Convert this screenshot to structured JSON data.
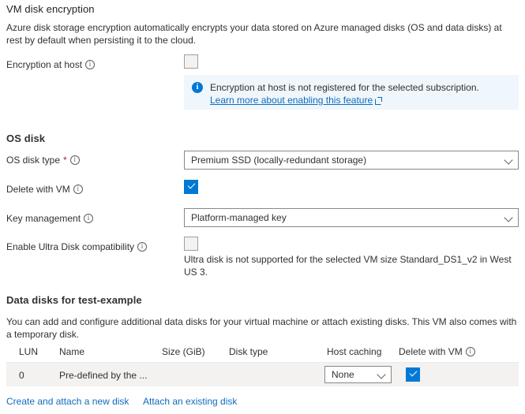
{
  "encryption_section": {
    "heading": "VM disk encryption",
    "description": "Azure disk storage encryption automatically encrypts your data stored on Azure managed disks (OS and data disks) at rest by default when persisting it to the cloud.",
    "encryption_at_host_label": "Encryption at host",
    "encryption_at_host_checked": false,
    "banner": {
      "icon": "info-icon",
      "message": "Encryption at host is not registered for the selected subscription.",
      "link_text": "Learn more about enabling this feature",
      "link_icon": "external-link-icon"
    }
  },
  "os_disk_section": {
    "heading": "OS disk",
    "os_disk_type": {
      "label": "OS disk type",
      "required_marker": "*",
      "value": "Premium SSD (locally-redundant storage)"
    },
    "delete_with_vm": {
      "label": "Delete with VM",
      "checked": true
    },
    "key_management": {
      "label": "Key management",
      "value": "Platform-managed key"
    },
    "ultra_disk": {
      "label": "Enable Ultra Disk compatibility",
      "checked": false,
      "note": "Ultra disk is not supported for the selected VM size Standard_DS1_v2 in West US 3."
    }
  },
  "data_disks_section": {
    "heading": "Data disks for test-example",
    "description": "You can add and configure additional data disks for your virtual machine or attach existing disks. This VM also comes with a temporary disk.",
    "columns": [
      "LUN",
      "Name",
      "Size (GiB)",
      "Disk type",
      "Host caching",
      "Delete with VM"
    ],
    "rows": [
      {
        "lun": "0",
        "name": "Pre-defined by the ...",
        "size": "",
        "disk_type": "",
        "host_caching": "None",
        "delete_with_vm": true
      }
    ],
    "actions": [
      {
        "label": "Create and attach a new disk"
      },
      {
        "label": "Attach an existing disk"
      }
    ]
  },
  "colors": {
    "accent": "#0078d4",
    "link": "#0f6cbd",
    "banner_bg": "#eff6fc",
    "row_bg": "#f3f2f1",
    "required": "#a4262c"
  }
}
